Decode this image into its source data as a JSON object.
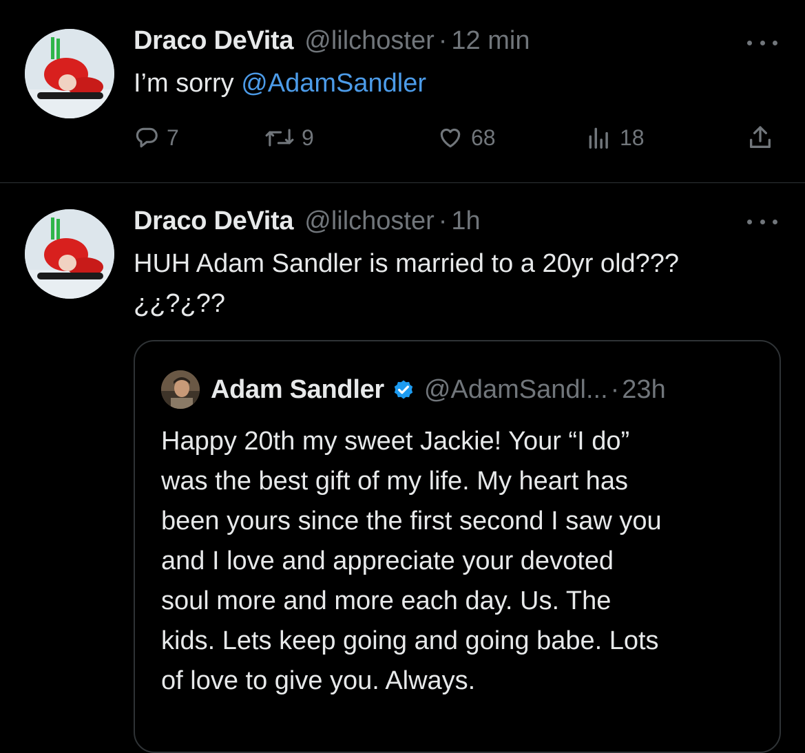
{
  "tweets": [
    {
      "author_name": "Draco DeVita",
      "handle": "@lilchoster",
      "separator": "·",
      "time": "12 min",
      "text_prefix": "I’m sorry ",
      "mention": "@AdamSandler",
      "stats": {
        "replies": "7",
        "retweets": "9",
        "likes": "68",
        "views": "18"
      }
    },
    {
      "author_name": "Draco DeVita",
      "handle": "@lilchoster",
      "separator": "·",
      "time": "1h",
      "text_lines": [
        "HUH Adam Sandler is married to a 20yr old???",
        "¿¿?¿??"
      ],
      "quoted": {
        "author_name": "Adam Sandler",
        "handle": "@AdamSandl...",
        "separator": "·",
        "time": "23h",
        "text_lines": [
          "Happy 20th my sweet Jackie! Your “I do”",
          "was the best gift of my life. My heart has",
          "been yours since the first second I saw you",
          "and I love and appreciate your devoted",
          "soul more and more each day. Us. The",
          "kids. Lets keep going and going babe. Lots",
          "of love to give you. Always."
        ]
      }
    }
  ],
  "icons": [
    "more-icon",
    "reply-icon",
    "retweet-icon",
    "like-icon",
    "views-icon",
    "share-icon",
    "verified-icon"
  ],
  "colors": {
    "background": "#000000",
    "primary_text": "#e7e9ea",
    "secondary_text": "#71767b",
    "link": "#4c9be8",
    "verified": "#1d9bf0",
    "border": "#2f3336"
  }
}
